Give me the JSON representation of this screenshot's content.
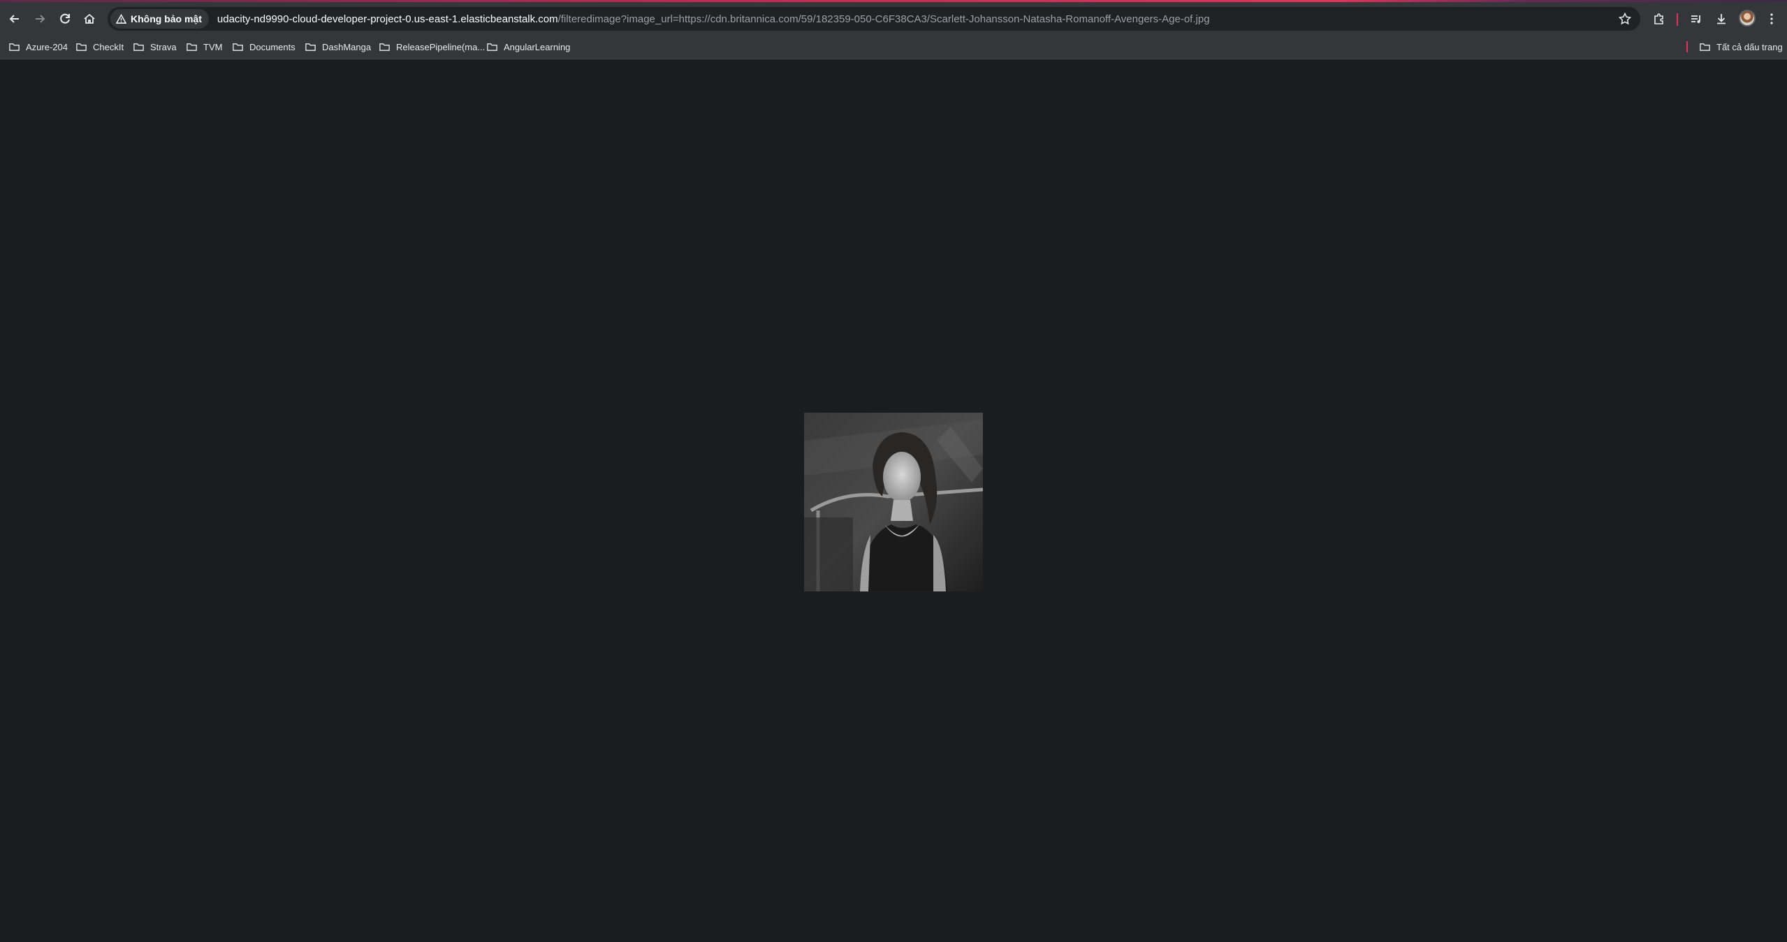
{
  "browser": {
    "security_label": "Không bảo mật",
    "url_host": "udacity-nd9990-cloud-developer-project-0.us-east-1.elasticbeanstalk.com",
    "url_path": "/filteredimage?image_url=https://cdn.britannica.com/59/182359-050-C6F38CA3/Scarlett-Johansson-Natasha-Romanoff-Avengers-Age-of.jpg",
    "accent_color": "#e0335d",
    "icons": [
      "back-icon",
      "forward-icon",
      "reload-icon",
      "home-icon",
      "warning-icon",
      "star-icon",
      "extensions-icon",
      "media-icon",
      "download-icon",
      "avatar",
      "menu-icon"
    ]
  },
  "bookmarks": {
    "items": [
      {
        "label": "Azure-204"
      },
      {
        "label": "CheckIt"
      },
      {
        "label": "Strava"
      },
      {
        "label": "TVM"
      },
      {
        "label": "Documents"
      },
      {
        "label": "DashManga"
      },
      {
        "label": "ReleasePipeline(ma..."
      },
      {
        "label": "AngularLearning"
      }
    ],
    "all_bookmarks_label": "Tất cả dấu trang"
  },
  "page": {
    "background": "#1b1c1e",
    "image": {
      "subject": "grayscale photo",
      "filter": "grayscale"
    }
  }
}
